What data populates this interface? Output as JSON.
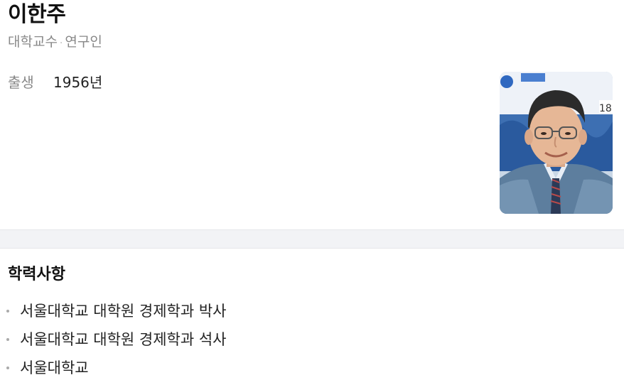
{
  "profile": {
    "name": "이한주",
    "occupations": [
      "대학교수",
      "연구인"
    ],
    "separator": "·",
    "birth": {
      "label": "출생",
      "value": "1956년"
    },
    "photo_alt": "이한주 프로필 사진"
  },
  "education": {
    "title": "학력사항",
    "items": [
      "서울대학교 대학원 경제학과 박사",
      "서울대학교 대학원 경제학과 석사",
      "서울대학교"
    ]
  }
}
